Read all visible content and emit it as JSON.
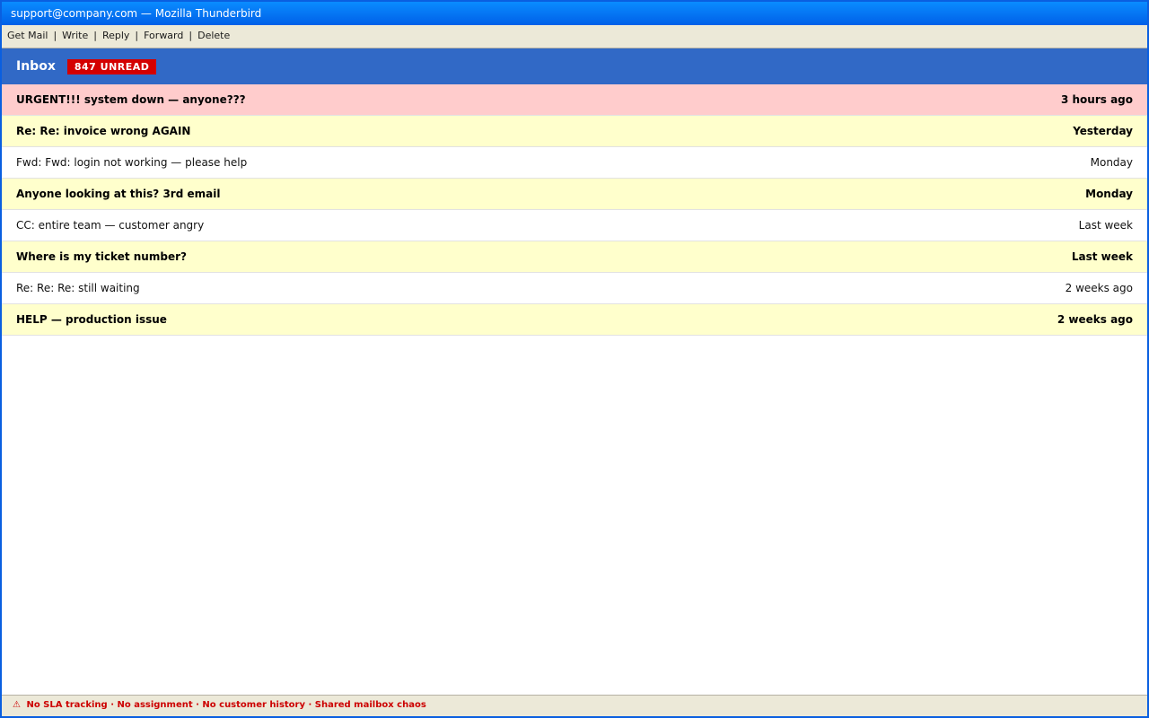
{
  "window": {
    "title": "support@company.com — Mozilla Thunderbird"
  },
  "toolbar": {
    "items": [
      "Get Mail",
      "Write",
      "Reply",
      "Forward",
      "Delete"
    ],
    "separator": "|"
  },
  "folder": {
    "name": "Inbox",
    "badge": "847 UNREAD"
  },
  "colors": {
    "urgent": "#ffcccc",
    "unread": "#ffffcc",
    "read": "#ffffff",
    "header": "#3169c6",
    "badge": "#d40000"
  },
  "messages": [
    {
      "subject": "URGENT!!! system down — anyone???",
      "date": "3 hours ago",
      "unread": true,
      "urgent": true
    },
    {
      "subject": "Re: Re: invoice wrong AGAIN",
      "date": "Yesterday",
      "unread": true,
      "urgent": false
    },
    {
      "subject": "Fwd: Fwd: login not working — please help",
      "date": "Monday",
      "unread": false,
      "urgent": false
    },
    {
      "subject": "Anyone looking at this? 3rd email",
      "date": "Monday",
      "unread": true,
      "urgent": false
    },
    {
      "subject": "CC: entire team — customer angry",
      "date": "Last week",
      "unread": false,
      "urgent": false
    },
    {
      "subject": "Where is my ticket number?",
      "date": "Last week",
      "unread": true,
      "urgent": false
    },
    {
      "subject": "Re: Re: Re: still waiting",
      "date": "2 weeks ago",
      "unread": false,
      "urgent": false
    },
    {
      "subject": "HELP — production issue",
      "date": "2 weeks ago",
      "unread": true,
      "urgent": false
    }
  ],
  "status": {
    "icon": "warning-icon",
    "icon_glyph": "⚠",
    "text": "No SLA tracking · No assignment · No customer history · Shared mailbox chaos"
  }
}
